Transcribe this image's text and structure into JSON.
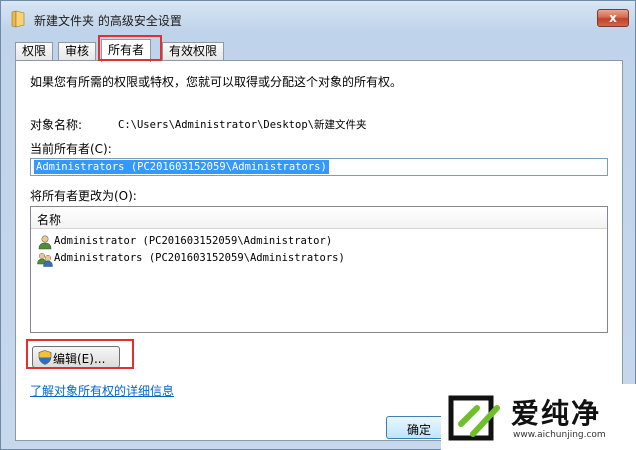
{
  "window": {
    "title": "新建文件夹 的高级安全设置",
    "close_symbol": "x"
  },
  "tabs": [
    {
      "label": "权限",
      "active": false
    },
    {
      "label": "审核",
      "active": false
    },
    {
      "label": "所有者",
      "active": true
    },
    {
      "label": "有效权限",
      "active": false
    }
  ],
  "owner_tab": {
    "intro": "如果您有所需的权限或特权，您就可以取得或分配这个对象的所有权。",
    "object_name_label": "对象名称:",
    "object_name_value": "C:\\Users\\Administrator\\Desktop\\新建文件夹",
    "current_owner_label": "当前所有者(C):",
    "current_owner_value": "Administrators (PC201603152059\\Administrators)",
    "change_owner_label": "将所有者更改为(O):",
    "list_header": "名称",
    "owners": [
      {
        "name": "Administrator (PC201603152059\\Administrator)",
        "icon": "user-icon"
      },
      {
        "name": "Administrators (PC201603152059\\Administrators)",
        "icon": "group-icon"
      }
    ],
    "edit_button": "编辑(E)...",
    "info_link": "了解对象所有权的详细信息"
  },
  "footer": {
    "ok_button": "确定"
  },
  "watermark": {
    "brand": "爱纯净",
    "url": "www.aichunjing.com"
  },
  "colors": {
    "highlight": "#e03030",
    "selection": "#3399ff",
    "link": "#0066cc"
  }
}
